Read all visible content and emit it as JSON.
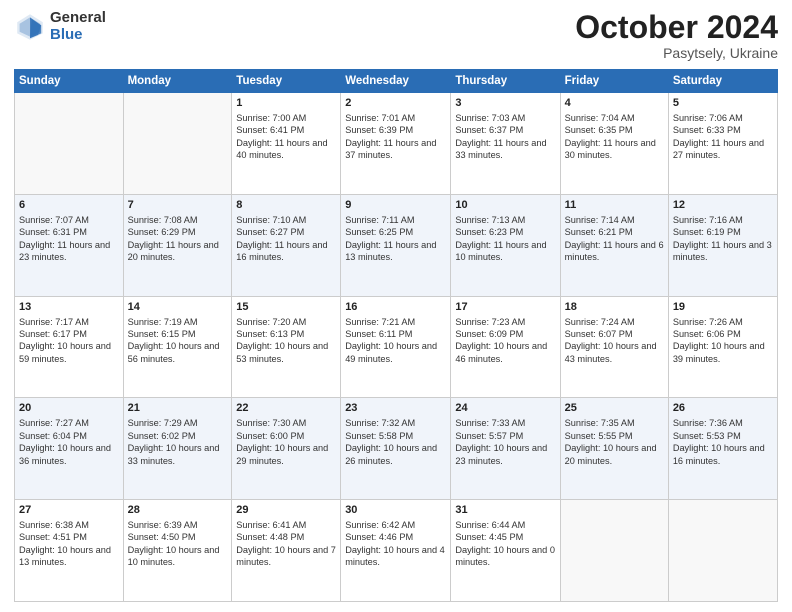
{
  "logo": {
    "general": "General",
    "blue": "Blue"
  },
  "header": {
    "month": "October 2024",
    "location": "Pasytsely, Ukraine"
  },
  "weekdays": [
    "Sunday",
    "Monday",
    "Tuesday",
    "Wednesday",
    "Thursday",
    "Friday",
    "Saturday"
  ],
  "weeks": [
    [
      {
        "day": "",
        "info": ""
      },
      {
        "day": "",
        "info": ""
      },
      {
        "day": "1",
        "info": "Sunrise: 7:00 AM\nSunset: 6:41 PM\nDaylight: 11 hours\nand 40 minutes."
      },
      {
        "day": "2",
        "info": "Sunrise: 7:01 AM\nSunset: 6:39 PM\nDaylight: 11 hours\nand 37 minutes."
      },
      {
        "day": "3",
        "info": "Sunrise: 7:03 AM\nSunset: 6:37 PM\nDaylight: 11 hours\nand 33 minutes."
      },
      {
        "day": "4",
        "info": "Sunrise: 7:04 AM\nSunset: 6:35 PM\nDaylight: 11 hours\nand 30 minutes."
      },
      {
        "day": "5",
        "info": "Sunrise: 7:06 AM\nSunset: 6:33 PM\nDaylight: 11 hours\nand 27 minutes."
      }
    ],
    [
      {
        "day": "6",
        "info": "Sunrise: 7:07 AM\nSunset: 6:31 PM\nDaylight: 11 hours\nand 23 minutes."
      },
      {
        "day": "7",
        "info": "Sunrise: 7:08 AM\nSunset: 6:29 PM\nDaylight: 11 hours\nand 20 minutes."
      },
      {
        "day": "8",
        "info": "Sunrise: 7:10 AM\nSunset: 6:27 PM\nDaylight: 11 hours\nand 16 minutes."
      },
      {
        "day": "9",
        "info": "Sunrise: 7:11 AM\nSunset: 6:25 PM\nDaylight: 11 hours\nand 13 minutes."
      },
      {
        "day": "10",
        "info": "Sunrise: 7:13 AM\nSunset: 6:23 PM\nDaylight: 11 hours\nand 10 minutes."
      },
      {
        "day": "11",
        "info": "Sunrise: 7:14 AM\nSunset: 6:21 PM\nDaylight: 11 hours\nand 6 minutes."
      },
      {
        "day": "12",
        "info": "Sunrise: 7:16 AM\nSunset: 6:19 PM\nDaylight: 11 hours\nand 3 minutes."
      }
    ],
    [
      {
        "day": "13",
        "info": "Sunrise: 7:17 AM\nSunset: 6:17 PM\nDaylight: 10 hours\nand 59 minutes."
      },
      {
        "day": "14",
        "info": "Sunrise: 7:19 AM\nSunset: 6:15 PM\nDaylight: 10 hours\nand 56 minutes."
      },
      {
        "day": "15",
        "info": "Sunrise: 7:20 AM\nSunset: 6:13 PM\nDaylight: 10 hours\nand 53 minutes."
      },
      {
        "day": "16",
        "info": "Sunrise: 7:21 AM\nSunset: 6:11 PM\nDaylight: 10 hours\nand 49 minutes."
      },
      {
        "day": "17",
        "info": "Sunrise: 7:23 AM\nSunset: 6:09 PM\nDaylight: 10 hours\nand 46 minutes."
      },
      {
        "day": "18",
        "info": "Sunrise: 7:24 AM\nSunset: 6:07 PM\nDaylight: 10 hours\nand 43 minutes."
      },
      {
        "day": "19",
        "info": "Sunrise: 7:26 AM\nSunset: 6:06 PM\nDaylight: 10 hours\nand 39 minutes."
      }
    ],
    [
      {
        "day": "20",
        "info": "Sunrise: 7:27 AM\nSunset: 6:04 PM\nDaylight: 10 hours\nand 36 minutes."
      },
      {
        "day": "21",
        "info": "Sunrise: 7:29 AM\nSunset: 6:02 PM\nDaylight: 10 hours\nand 33 minutes."
      },
      {
        "day": "22",
        "info": "Sunrise: 7:30 AM\nSunset: 6:00 PM\nDaylight: 10 hours\nand 29 minutes."
      },
      {
        "day": "23",
        "info": "Sunrise: 7:32 AM\nSunset: 5:58 PM\nDaylight: 10 hours\nand 26 minutes."
      },
      {
        "day": "24",
        "info": "Sunrise: 7:33 AM\nSunset: 5:57 PM\nDaylight: 10 hours\nand 23 minutes."
      },
      {
        "day": "25",
        "info": "Sunrise: 7:35 AM\nSunset: 5:55 PM\nDaylight: 10 hours\nand 20 minutes."
      },
      {
        "day": "26",
        "info": "Sunrise: 7:36 AM\nSunset: 5:53 PM\nDaylight: 10 hours\nand 16 minutes."
      }
    ],
    [
      {
        "day": "27",
        "info": "Sunrise: 6:38 AM\nSunset: 4:51 PM\nDaylight: 10 hours\nand 13 minutes."
      },
      {
        "day": "28",
        "info": "Sunrise: 6:39 AM\nSunset: 4:50 PM\nDaylight: 10 hours\nand 10 minutes."
      },
      {
        "day": "29",
        "info": "Sunrise: 6:41 AM\nSunset: 4:48 PM\nDaylight: 10 hours\nand 7 minutes."
      },
      {
        "day": "30",
        "info": "Sunrise: 6:42 AM\nSunset: 4:46 PM\nDaylight: 10 hours\nand 4 minutes."
      },
      {
        "day": "31",
        "info": "Sunrise: 6:44 AM\nSunset: 4:45 PM\nDaylight: 10 hours\nand 0 minutes."
      },
      {
        "day": "",
        "info": ""
      },
      {
        "day": "",
        "info": ""
      }
    ]
  ]
}
